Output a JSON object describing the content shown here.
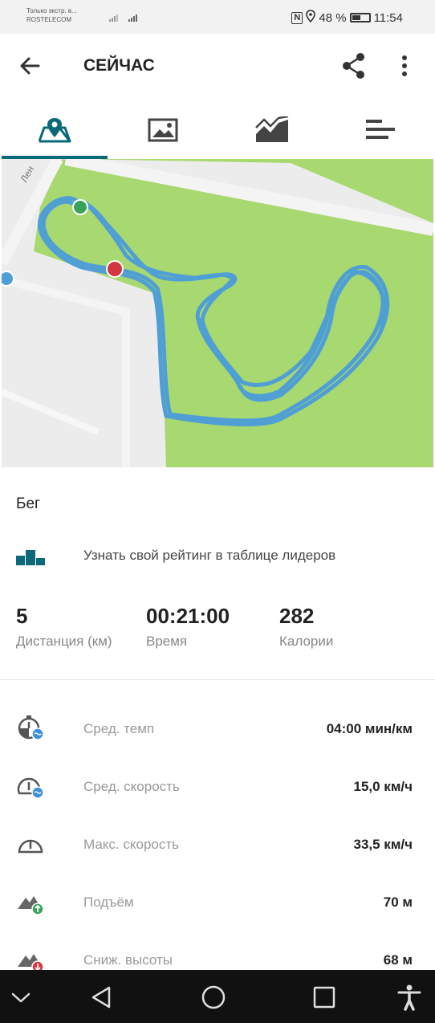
{
  "status": {
    "carrier_line1": "Только экстр. в...",
    "carrier_line2": "ROSTELECOM",
    "signal": "⁴ᴳ",
    "nfc": "N",
    "battery_percent": "48 %",
    "time": "11:54"
  },
  "header": {
    "title": "СЕЙЧАС"
  },
  "tabs": [
    {
      "name": "map",
      "icon": "map-pin-icon",
      "active": true
    },
    {
      "name": "photos",
      "icon": "image-icon",
      "active": false
    },
    {
      "name": "chart",
      "icon": "area-chart-icon",
      "active": false
    },
    {
      "name": "laps",
      "icon": "bars-icon",
      "active": false
    }
  ],
  "map": {
    "street_label": "Лен",
    "colors": {
      "park": "#a8d870",
      "road": "#f1f1f1",
      "route": "#4f9fd4",
      "start": "#3aa15a",
      "finish": "#d43640"
    }
  },
  "activity": {
    "sport": "Бег",
    "leaderboard_text": "Узнать свой рейтинг в таблице лидеров"
  },
  "summary": {
    "distance": {
      "value": "5",
      "label": "Дистанция (км)"
    },
    "time": {
      "value": "00:21:00",
      "label": "Время"
    },
    "calories": {
      "value": "282",
      "label": "Калории"
    }
  },
  "stats": [
    {
      "icon": "pace-icon",
      "label": "Сред. темп",
      "value": "04:00 мин/км"
    },
    {
      "icon": "speedometer-icon",
      "label": "Сред. скорость",
      "value": "15,0 км/ч"
    },
    {
      "icon": "speedometer-max-icon",
      "label": "Макс. скорость",
      "value": "33,5 км/ч"
    },
    {
      "icon": "ascent-icon",
      "label": "Подъём",
      "value": "70 м"
    },
    {
      "icon": "descent-icon",
      "label": "Сниж. высоты",
      "value": "68 м"
    }
  ],
  "accent": "#0a6a78"
}
